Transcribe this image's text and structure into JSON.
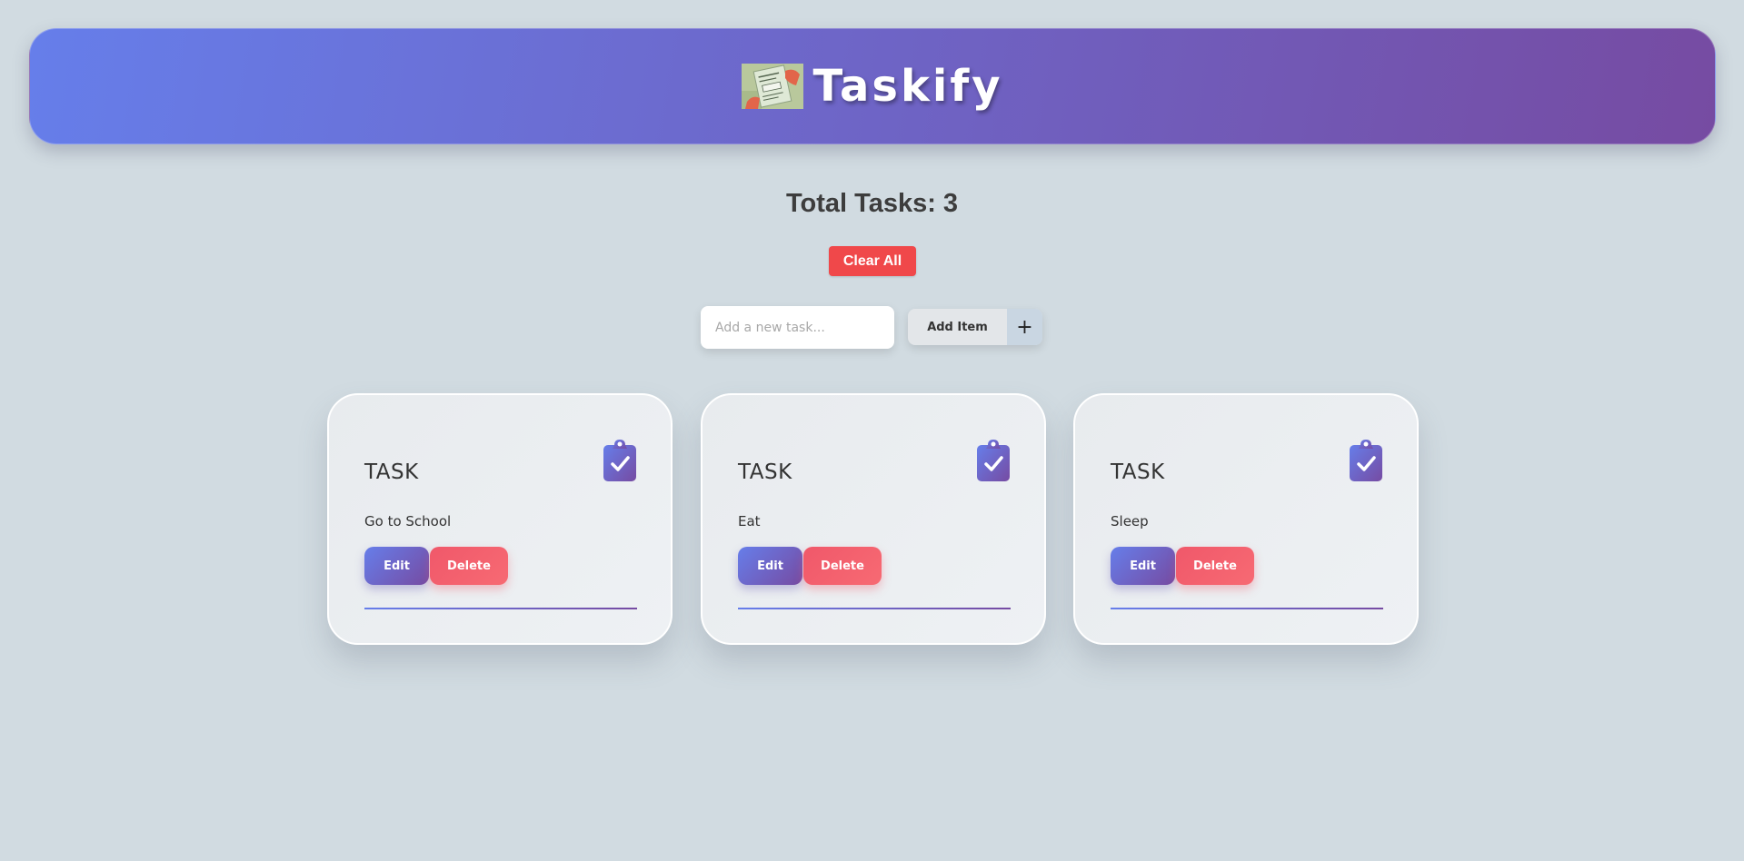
{
  "header": {
    "title": "Taskify",
    "logo_icon": "sticky-note-checklist-logo"
  },
  "summary": {
    "total_label": "Total Tasks:",
    "total_count": "3"
  },
  "actions": {
    "clear_all_label": "Clear All"
  },
  "new_task": {
    "value": "",
    "placeholder": "Add a new task...",
    "add_label": "Add Item",
    "add_icon_glyph": "+"
  },
  "tasks": [
    {
      "heading": "TASK",
      "text": "Go to School",
      "edit_label": "Edit",
      "delete_label": "Delete",
      "icon": "clipboard-check-icon"
    },
    {
      "heading": "TASK",
      "text": "Eat",
      "edit_label": "Edit",
      "delete_label": "Delete",
      "icon": "clipboard-check-icon"
    },
    {
      "heading": "TASK",
      "text": "Sleep",
      "edit_label": "Edit",
      "delete_label": "Delete",
      "icon": "clipboard-check-icon"
    }
  ],
  "colors": {
    "page_background": "#d1dbe1",
    "header_gradient_start": "#667eea",
    "header_gradient_end": "#764ba2",
    "clear_all": "#f0484a",
    "edit_button": "#6b6fd8",
    "delete_button": "#f4626f",
    "clipboard_icon": "#7160c8"
  }
}
